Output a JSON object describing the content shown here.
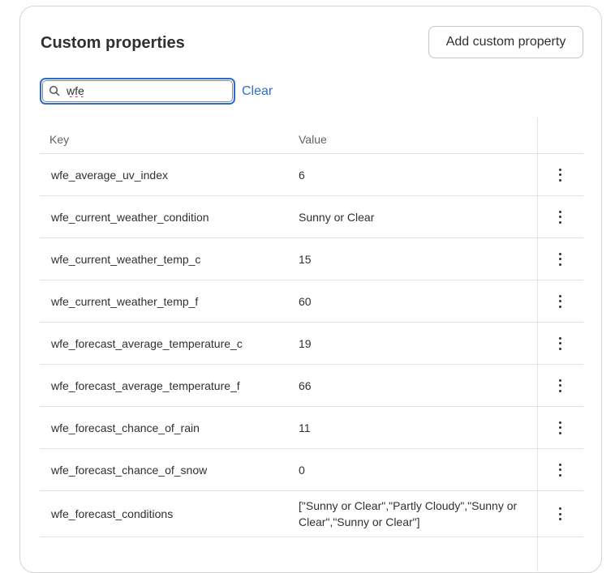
{
  "header": {
    "title": "Custom properties",
    "add_button_label": "Add custom property"
  },
  "search": {
    "value": "wfe",
    "clear_label": "Clear",
    "icon": "search-icon"
  },
  "table": {
    "columns": {
      "key": "Key",
      "value": "Value"
    },
    "rows": [
      {
        "key": "wfe_average_uv_index",
        "value": "6"
      },
      {
        "key": "wfe_current_weather_condition",
        "value": "Sunny or Clear"
      },
      {
        "key": "wfe_current_weather_temp_c",
        "value": "15"
      },
      {
        "key": "wfe_current_weather_temp_f",
        "value": "60"
      },
      {
        "key": "wfe_forecast_average_temperature_c",
        "value": "19"
      },
      {
        "key": "wfe_forecast_average_temperature_f",
        "value": "66"
      },
      {
        "key": "wfe_forecast_chance_of_rain",
        "value": "11"
      },
      {
        "key": "wfe_forecast_chance_of_snow",
        "value": "0"
      },
      {
        "key": "wfe_forecast_conditions",
        "value": "[\"Sunny or Clear\",\"Partly Cloudy\",\"Sunny or Clear\",\"Sunny or Clear\"]"
      }
    ],
    "row_action_icon": "more-vertical-icon"
  },
  "colors": {
    "accent": "#2c6ecb",
    "text": "#303030",
    "muted": "#616161",
    "border": "#e3e3e3"
  }
}
